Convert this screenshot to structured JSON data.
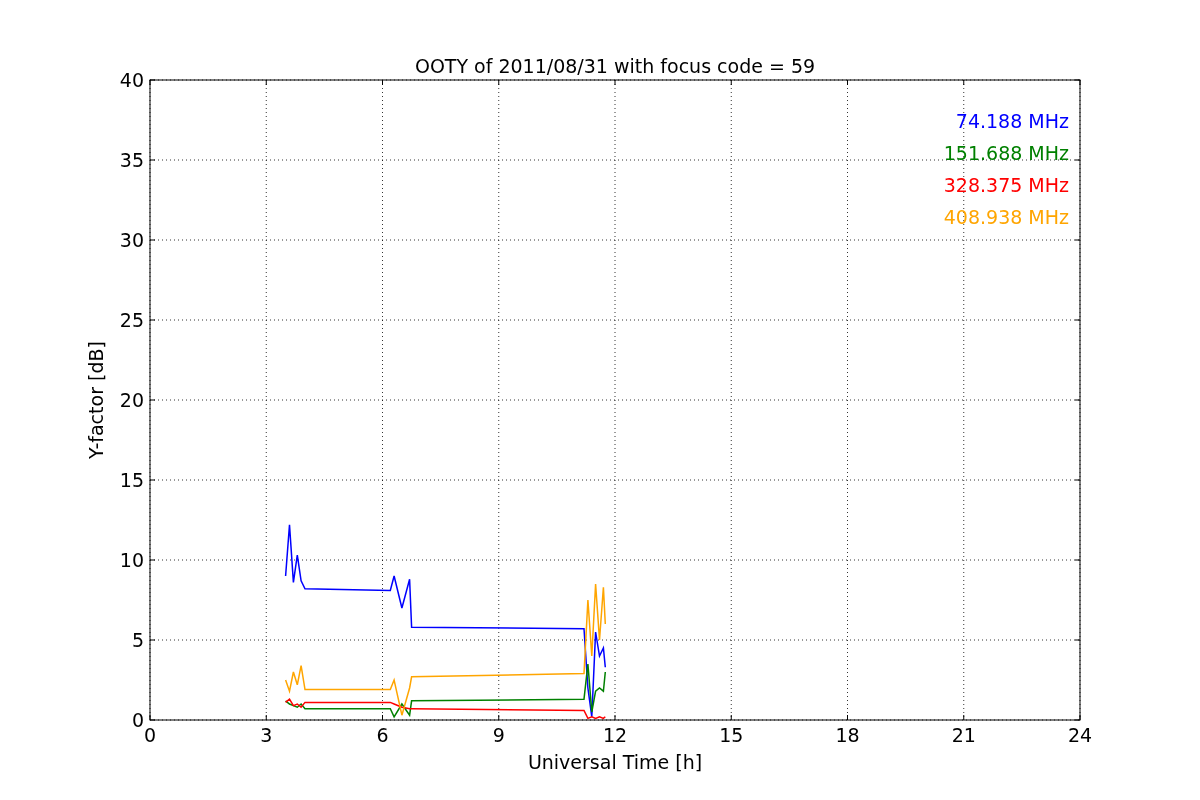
{
  "chart_data": {
    "type": "line",
    "title": "OOTY of 2011/08/31 with focus code = 59",
    "xlabel": "Universal Time [h]",
    "ylabel": "Y-factor [dB]",
    "x": [
      3.5,
      3.6,
      3.7,
      3.8,
      3.9,
      4.0,
      6.2,
      6.3,
      6.5,
      6.7,
      6.75,
      11.2,
      11.3,
      11.4,
      11.5,
      11.6,
      11.7,
      11.75
    ],
    "series": [
      {
        "name": "74.188 MHz",
        "color": "#0000ff",
        "values": [
          9,
          12.2,
          8.6,
          10.3,
          8.7,
          8.2,
          8.1,
          9.0,
          7.0,
          8.8,
          5.8,
          5.7,
          2.0,
          0.2,
          5.5,
          4.0,
          4.5,
          3.3
        ]
      },
      {
        "name": "151.688 MHz",
        "color": "#008000",
        "values": [
          1.2,
          1.0,
          0.9,
          0.8,
          1.0,
          0.7,
          0.7,
          0.2,
          1.0,
          0.3,
          1.2,
          1.3,
          3.5,
          0.5,
          1.8,
          2.0,
          1.8,
          3.0
        ]
      },
      {
        "name": "328.375 MHz",
        "color": "#ff0000",
        "values": [
          1.1,
          1.3,
          0.9,
          1.0,
          0.8,
          1.1,
          1.1,
          1.0,
          0.8,
          0.7,
          0.7,
          0.6,
          0.1,
          0.2,
          0.1,
          0.2,
          0.1,
          0.2
        ]
      },
      {
        "name": "408.938 MHz",
        "color": "#ffa500",
        "values": [
          2.5,
          1.8,
          3.0,
          2.2,
          3.4,
          1.9,
          1.9,
          2.5,
          0.3,
          2.0,
          2.7,
          2.9,
          7.5,
          4.0,
          8.5,
          5.0,
          8.3,
          6.0
        ]
      }
    ],
    "xlim": [
      0,
      24
    ],
    "ylim": [
      0,
      40
    ],
    "xticks": [
      0,
      3,
      6,
      9,
      12,
      15,
      18,
      21,
      24
    ],
    "yticks": [
      0,
      5,
      10,
      15,
      20,
      25,
      30,
      35,
      40
    ],
    "grid": true
  }
}
